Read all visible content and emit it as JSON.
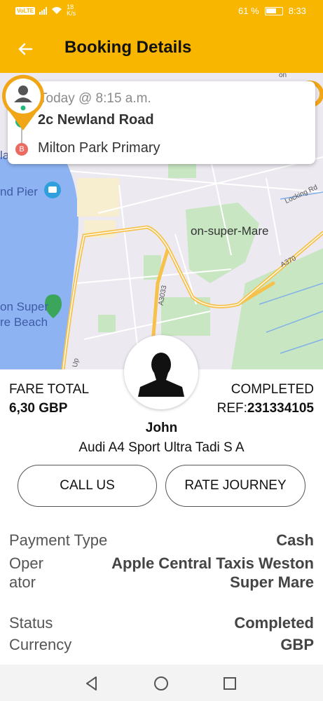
{
  "status_bar": {
    "network_chip": "VoLTE",
    "speed_value": "18",
    "speed_unit": "K/s",
    "battery": "61 %",
    "time": "8:33"
  },
  "header": {
    "title": "Booking Details",
    "back_icon": "arrow-left-icon"
  },
  "map": {
    "labels": {
      "pier": "nd Pier",
      "place": "on-super-Mare",
      "beach_line1": "on Super",
      "beach_line2": "re Beach",
      "road_locking": "Locking Rd",
      "road_a370": "A370",
      "road_a3033": "A3033",
      "edge_lay": "lay",
      "edge_up": "Up",
      "edge_on": "on"
    },
    "colors": {
      "water": "#8db3f2",
      "park": "#c8e6c2",
      "road": "#f6c24c",
      "land": "#eceaf0"
    }
  },
  "route": {
    "time": "Today @ 8:15 a.m.",
    "pickup_marker": "A",
    "pickup": "2c Newland Road",
    "drop_marker": "B",
    "dropoff": "Milton Park Primary"
  },
  "fare": {
    "label": "FARE TOTAL",
    "value": "6,30 GBP"
  },
  "booking": {
    "status": "COMPLETED",
    "ref_label": "REF:",
    "ref_value": "231334105"
  },
  "driver": {
    "name": "John",
    "vehicle": "Audi A4 Sport Ultra Tadi S A"
  },
  "actions": {
    "call": "CALL US",
    "rate": "RATE JOURNEY"
  },
  "details": [
    {
      "key": "Payment Type",
      "value": "Cash"
    },
    {
      "key": "Operator",
      "value": "Apple Central Taxis Weston Super Mare"
    },
    {
      "key": "Status",
      "value": "Completed"
    },
    {
      "key": "Currency",
      "value": "GBP"
    }
  ],
  "colors": {
    "accent": "#f9b600",
    "pickup": "#21b97a",
    "dropoff": "#e96b62"
  }
}
